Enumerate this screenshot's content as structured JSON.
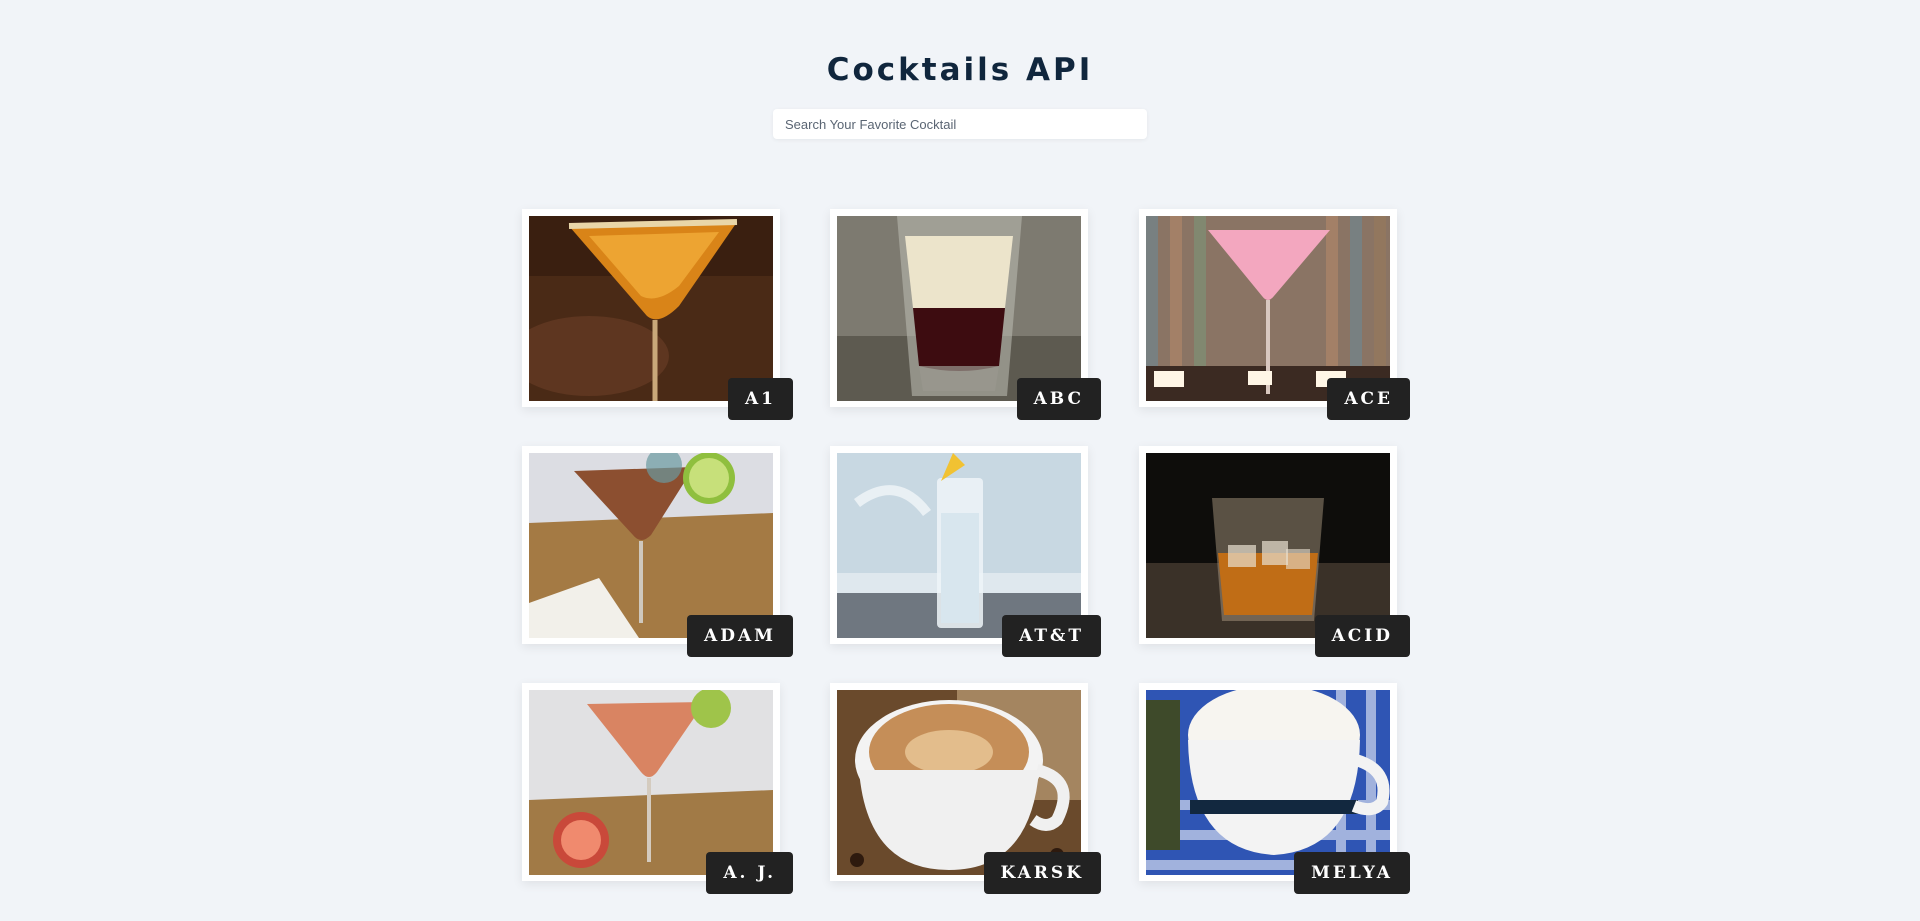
{
  "header": {
    "title": "Cocktails API"
  },
  "search": {
    "placeholder": "Search Your Favorite Cocktail",
    "value": ""
  },
  "cocktails": [
    {
      "name": "A1",
      "image": "martini-orange-sugar-rim"
    },
    {
      "name": "ABC",
      "image": "layered-shot-glass"
    },
    {
      "name": "ACE",
      "image": "pink-martini-candles"
    },
    {
      "name": "ADAM",
      "image": "martini-lime-wheel"
    },
    {
      "name": "AT&T",
      "image": "highball-ice-lemon"
    },
    {
      "name": "ACID",
      "image": "whiskey-rocks-glass"
    },
    {
      "name": "A. J.",
      "image": "grapefruit-martini"
    },
    {
      "name": "KARSK",
      "image": "latte-cup-coffee-beans"
    },
    {
      "name": "MELYA",
      "image": "cappuccino-checkered-cloth"
    }
  ]
}
